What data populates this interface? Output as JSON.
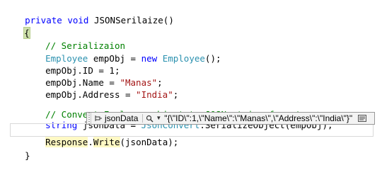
{
  "code": {
    "line1": {
      "kw1": "private",
      "kw2": "void",
      "rest": " JSONSerilaize()"
    },
    "line2": {
      "brace": "{"
    },
    "line3": {
      "comment": "// Serializaion"
    },
    "line4": {
      "type1": "Employee",
      "mid": " empObj = ",
      "kw": "new",
      "type2": "Employee",
      "end": "();"
    },
    "line5": {
      "text": "empObj.ID = 1;"
    },
    "line6": {
      "pre": "empObj.Name = ",
      "str": "\"Manas\"",
      "end": ";"
    },
    "line7": {
      "pre": "empObj.Address = ",
      "str": "\"India\"",
      "end": ";"
    },
    "line8": {
      "comment": "// Convert Employee object to JOSN string format"
    },
    "line9": {
      "kw": "string",
      "mid": " jsonData = ",
      "type": "JsonConvert",
      "end": ".SerializeObject(empObj);"
    },
    "line10": {
      "resp": "Response",
      "dot": ".",
      "write": "Write",
      "end": "(jsonData);"
    },
    "line11": {
      "brace": "}"
    }
  },
  "datatip": {
    "variable": "jsonData",
    "value": "\"{\\\"ID\\\":1,\\\"Name\\\":\\\"Manas\\\",\\\"Address\\\":\\\"India\\\"}\"",
    "icons": [
      "pin-icon",
      "magnifier-icon",
      "dropdown-arrow-icon",
      "text-visualizer-icon"
    ]
  },
  "colors": {
    "keyword": "#0000ff",
    "type": "#2b91af",
    "string": "#a31515",
    "comment": "#008000"
  }
}
